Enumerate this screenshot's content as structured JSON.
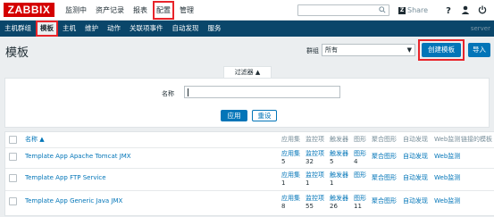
{
  "logo": "ZABBIX",
  "top_menu": [
    {
      "label": "监测中"
    },
    {
      "label": "资产记录"
    },
    {
      "label": "报表"
    },
    {
      "label": "配置"
    },
    {
      "label": "管理"
    }
  ],
  "share_label": "Share",
  "share_badge": "Z",
  "sub_menu": [
    {
      "label": "主机群组"
    },
    {
      "label": "模板"
    },
    {
      "label": "主机"
    },
    {
      "label": "维护"
    },
    {
      "label": "动作"
    },
    {
      "label": "关联项事件"
    },
    {
      "label": "自动发现"
    },
    {
      "label": "服务"
    }
  ],
  "server_label": "server",
  "page_title": "模板",
  "group_label": "群组",
  "group_value": "所有",
  "create_label": "创建模板",
  "import_label": "导入",
  "filter_tab": "过滤器 ▲",
  "filter_name_label": "名称",
  "apply_label": "应用",
  "reset_label": "重设",
  "columns": {
    "name": "名称 ▲",
    "apps": "应用集",
    "items": "监控项",
    "triggers": "触发器",
    "graphs": "图形",
    "screens": "聚合图形",
    "discovery": "自动发现",
    "web": "Web监测",
    "linked": "链接的模板",
    "linked_cut": "链接"
  },
  "rows": [
    {
      "name": "Template App Apache Tomcat JMX",
      "apps": "应用集",
      "apps_n": "5",
      "items": "监控项",
      "items_n": "32",
      "triggers": "触发器",
      "triggers_n": "5",
      "graphs": "图形",
      "graphs_n": "4",
      "screens": "聚合图形",
      "discovery": "自动发现",
      "web": "Web监测"
    },
    {
      "name": "Template App FTP Service",
      "apps": "应用集",
      "apps_n": "1",
      "items": "监控项",
      "items_n": "1",
      "triggers": "触发器",
      "triggers_n": "1",
      "graphs": "图形",
      "graphs_n": "",
      "screens": "聚合图形",
      "discovery": "自动发现",
      "web": "Web监测"
    },
    {
      "name": "Template App Generic Java JMX",
      "apps": "应用集",
      "apps_n": "8",
      "items": "监控项",
      "items_n": "55",
      "triggers": "触发器",
      "triggers_n": "26",
      "graphs": "图形",
      "graphs_n": "11",
      "screens": "聚合图形",
      "discovery": "自动发现",
      "web": "Web监测"
    }
  ],
  "colors": {
    "brand": "#d40000",
    "nav": "#0a466a",
    "accent": "#0275b8",
    "highlight": "#e8242a"
  }
}
